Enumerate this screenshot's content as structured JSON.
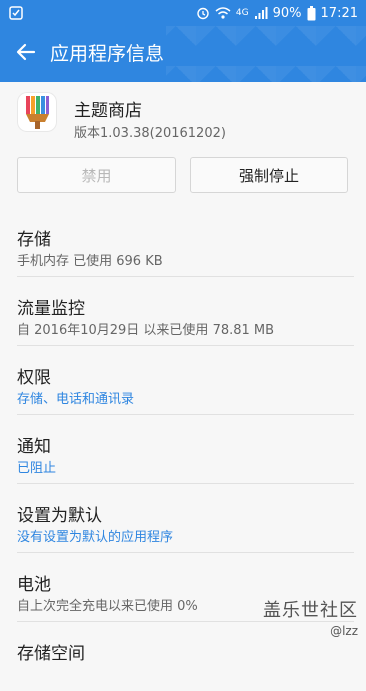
{
  "status_bar": {
    "battery": "90%",
    "time": "17:21",
    "network": "4G"
  },
  "header": {
    "title": "应用程序信息"
  },
  "app": {
    "name": "主题商店",
    "version": "版本1.03.38(20161202)"
  },
  "buttons": {
    "disable": "禁用",
    "force_stop": "强制停止"
  },
  "sections": [
    {
      "title": "存储",
      "subtitle": "手机内存 已使用 696 KB",
      "subtitle_color": "gray"
    },
    {
      "title": "流量监控",
      "subtitle": "自 2016年10月29日 以来已使用 78.81 MB",
      "subtitle_color": "gray"
    },
    {
      "title": "权限",
      "subtitle": "存储、电话和通讯录",
      "subtitle_color": "blue"
    },
    {
      "title": "通知",
      "subtitle": "已阻止",
      "subtitle_color": "blue"
    },
    {
      "title": "设置为默认",
      "subtitle": "没有设置为默认的应用程序",
      "subtitle_color": "blue"
    },
    {
      "title": "电池",
      "subtitle": "自上次完全充电以来已使用 0%",
      "subtitle_color": "gray"
    },
    {
      "title": "存储空间",
      "subtitle": "",
      "subtitle_color": "gray"
    }
  ],
  "watermark": {
    "brand": "盖乐世社区",
    "user": "@lzz"
  },
  "colors": {
    "accent": "#2f86e0",
    "link_text": "#2f86e0",
    "secondary_text": "#666666"
  }
}
